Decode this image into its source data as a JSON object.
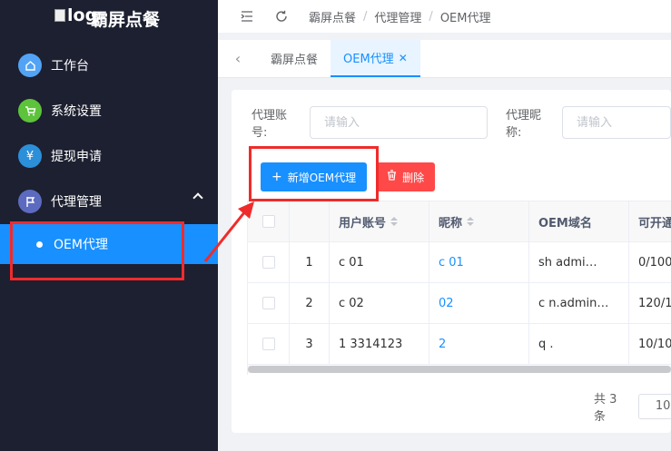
{
  "app": {
    "logo_alt": "log",
    "title": "霸屏点餐"
  },
  "sidebar": {
    "items": [
      {
        "label": "工作台",
        "icon": "home-icon",
        "color": "#52a3f5"
      },
      {
        "label": "系统设置",
        "icon": "cart-icon",
        "color": "#5cc33b"
      },
      {
        "label": "提现申请",
        "icon": "yen-icon",
        "color": "#2c8fd9"
      },
      {
        "label": "代理管理",
        "icon": "flag-icon",
        "color": "#5c6bc0"
      }
    ],
    "sub_items": [
      {
        "label": "OEM代理"
      }
    ]
  },
  "topbar": {
    "breadcrumb": [
      "霸屏点餐",
      "代理管理",
      "OEM代理"
    ]
  },
  "tabs": [
    {
      "label": "霸屏点餐",
      "active": false
    },
    {
      "label": "OEM代理",
      "active": true
    }
  ],
  "filters": {
    "account_label": "代理账号:",
    "account_placeholder": "请输入",
    "nickname_label": "代理昵称:",
    "nickname_placeholder": "请输入"
  },
  "toolbar": {
    "add_label": "新增OEM代理",
    "delete_label": "删除",
    "add_color": "#1890ff",
    "delete_color": "#ff4949"
  },
  "table": {
    "headers": [
      "用户账号",
      "昵称",
      "OEM域名",
      "可开通"
    ],
    "rows": [
      {
        "index": "1",
        "account": "c    01",
        "nickname": "c    01",
        "domain": "sh      admi…",
        "quota": "0/100"
      },
      {
        "index": "2",
        "account": "c    02",
        "nickname": "     02",
        "domain": "c     n.admin…",
        "quota": "120/1"
      },
      {
        "index": "3",
        "account": "1     3314123",
        "nickname": "     2",
        "domain": "q .",
        "quota": "10/10"
      }
    ]
  },
  "pagination": {
    "total": "共 3 条",
    "page_size": "10"
  }
}
